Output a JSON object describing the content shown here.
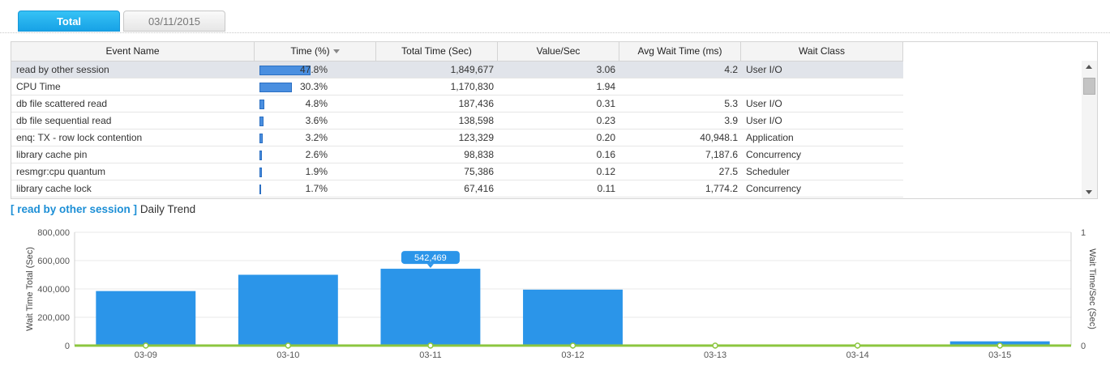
{
  "tabs": [
    {
      "label": "Total",
      "active": true
    },
    {
      "label": "03/11/2015",
      "active": false
    }
  ],
  "table": {
    "columns": [
      "Event Name",
      "Time (%)",
      "Total Time (Sec)",
      "Value/Sec",
      "Avg Wait Time (ms)",
      "Wait Class"
    ],
    "sorted_column": "Time (%)",
    "rows": [
      {
        "event": "read by other session",
        "pct": "47.8%",
        "pct_value": 47.8,
        "total": "1,849,677",
        "vps": "3.06",
        "avg": "4.2",
        "wclass": "User I/O",
        "selected": true
      },
      {
        "event": "CPU Time",
        "pct": "30.3%",
        "pct_value": 30.3,
        "total": "1,170,830",
        "vps": "1.94",
        "avg": "",
        "wclass": ""
      },
      {
        "event": "db file scattered read",
        "pct": "4.8%",
        "pct_value": 4.8,
        "total": "187,436",
        "vps": "0.31",
        "avg": "5.3",
        "wclass": "User I/O"
      },
      {
        "event": "db file sequential read",
        "pct": "3.6%",
        "pct_value": 3.6,
        "total": "138,598",
        "vps": "0.23",
        "avg": "3.9",
        "wclass": "User I/O"
      },
      {
        "event": "enq: TX - row lock contention",
        "pct": "3.2%",
        "pct_value": 3.2,
        "total": "123,329",
        "vps": "0.20",
        "avg": "40,948.1",
        "wclass": "Application"
      },
      {
        "event": "library cache pin",
        "pct": "2.6%",
        "pct_value": 2.6,
        "total": "98,838",
        "vps": "0.16",
        "avg": "7,187.6",
        "wclass": "Concurrency"
      },
      {
        "event": "resmgr:cpu quantum",
        "pct": "1.9%",
        "pct_value": 1.9,
        "total": "75,386",
        "vps": "0.12",
        "avg": "27.5",
        "wclass": "Scheduler"
      },
      {
        "event": "library cache lock",
        "pct": "1.7%",
        "pct_value": 1.7,
        "total": "67,416",
        "vps": "0.11",
        "avg": "1,774.2",
        "wclass": "Concurrency"
      }
    ]
  },
  "trend": {
    "selected_event": "[ read by other session ]",
    "title_suffix": "Daily Trend"
  },
  "chart_data": {
    "type": "bar",
    "categories": [
      "03-09",
      "03-10",
      "03-11",
      "03-12",
      "03-13",
      "03-14",
      "03-15"
    ],
    "series": [
      {
        "values": [
          385000,
          500000,
          542469,
          395000,
          0,
          0,
          30000
        ],
        "axis": "left",
        "color": "#2b95e9"
      },
      {
        "values": [
          0,
          0,
          0,
          0,
          0,
          0,
          0
        ],
        "axis": "right",
        "color": "#8cc63f",
        "render": "line"
      }
    ],
    "ylabel": "Wait Time Total (Sec)",
    "y2label": "Wait Time/Sec (Sec)",
    "ylim": [
      0,
      800000
    ],
    "y2lim": [
      0,
      1
    ],
    "yticks": [
      "0",
      "200,000",
      "400,000",
      "600,000",
      "800,000"
    ],
    "y2ticks": [
      "0",
      "1"
    ],
    "tooltip": {
      "category": "03-11",
      "label": "542,469"
    },
    "grid": true
  },
  "colors": {
    "accent": "#1d8fd6",
    "bar": "#2b95e9",
    "line": "#8cc63f",
    "tooltip_bg": "#2b95e9"
  }
}
